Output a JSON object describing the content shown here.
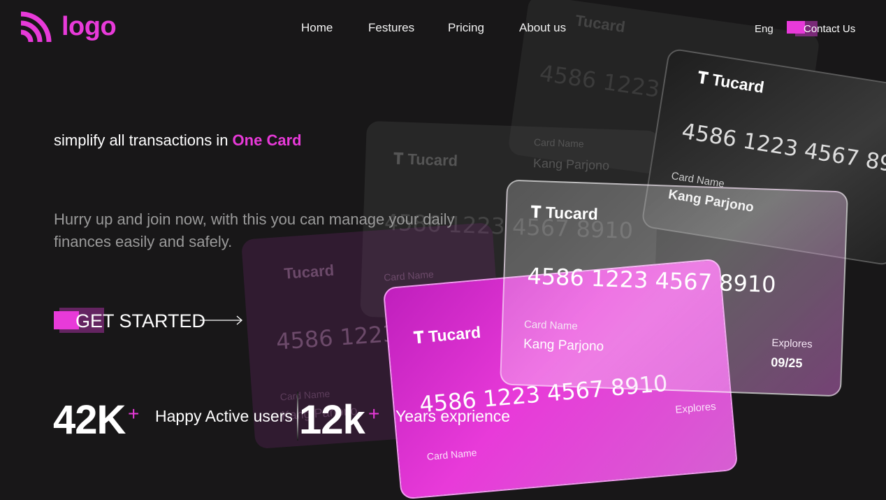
{
  "header": {
    "logo_text": "logo",
    "nav": [
      "Home",
      "Festures",
      "Pricing",
      "About us"
    ],
    "language": "Eng",
    "contact_label": "Contact Us"
  },
  "hero": {
    "headline_prefix": "simplify all transactions in ",
    "headline_highlight": "One Card",
    "subtext": "Hurry up and join now, with this you can manage your daily finances easily and safely.",
    "cta_label": "GET STARTED"
  },
  "stats": [
    {
      "value": "42K",
      "plus": "+",
      "label": "Happy Active users"
    },
    {
      "value": "12k",
      "plus": "+",
      "label": "Years exprience"
    }
  ],
  "card": {
    "brand": "Tucard",
    "number": "4586 1223 4567 8910",
    "name_label": "Card Name",
    "name": "Kang Parjono",
    "expiry_label": "Explores",
    "expiry": "09/25"
  },
  "colors": {
    "accent": "#e83ad9",
    "background": "#181718"
  }
}
